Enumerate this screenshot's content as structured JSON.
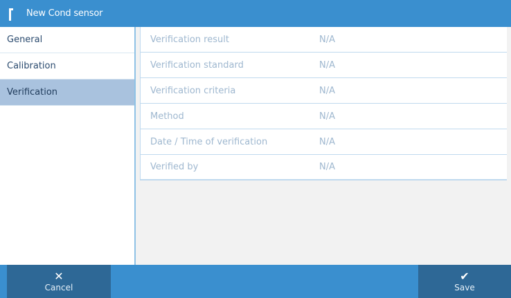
{
  "header": {
    "title": "New Cond sensor",
    "icon": "sensor-icon"
  },
  "sidebar": {
    "items": [
      {
        "label": "General",
        "active": false
      },
      {
        "label": "Calibration",
        "active": false
      },
      {
        "label": "Verification",
        "active": true
      }
    ]
  },
  "verification": {
    "rows": [
      {
        "label": "Verification result",
        "value": "N/A"
      },
      {
        "label": "Verification standard",
        "value": "N/A"
      },
      {
        "label": "Verification criteria",
        "value": "N/A"
      },
      {
        "label": "Method",
        "value": "N/A"
      },
      {
        "label": "Date / Time of verification",
        "value": "N/A"
      },
      {
        "label": "Verified by",
        "value": "N/A"
      }
    ]
  },
  "footer": {
    "cancel": {
      "label": "Cancel",
      "icon": "close-icon"
    },
    "save": {
      "label": "Save",
      "icon": "checkmark-icon"
    }
  },
  "colors": {
    "accent": "#3a8fcf",
    "footer_button": "#2e6896",
    "active_item": "#a9c2de"
  }
}
